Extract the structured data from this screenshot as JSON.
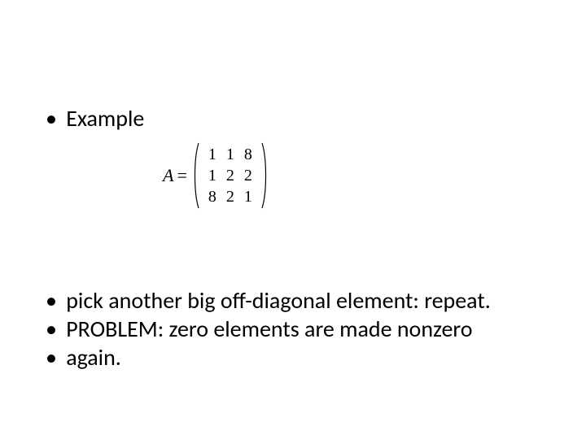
{
  "bullets_top": [
    "Example"
  ],
  "matrix": {
    "lhs": "A",
    "eq": "=",
    "rows": [
      [
        "1",
        "1",
        "8"
      ],
      [
        "1",
        "2",
        "2"
      ],
      [
        "8",
        "2",
        "1"
      ]
    ]
  },
  "bullets_bottom": [
    "pick another big off-diagonal element: repeat.",
    "PROBLEM: zero elements are made nonzero",
    "again."
  ]
}
